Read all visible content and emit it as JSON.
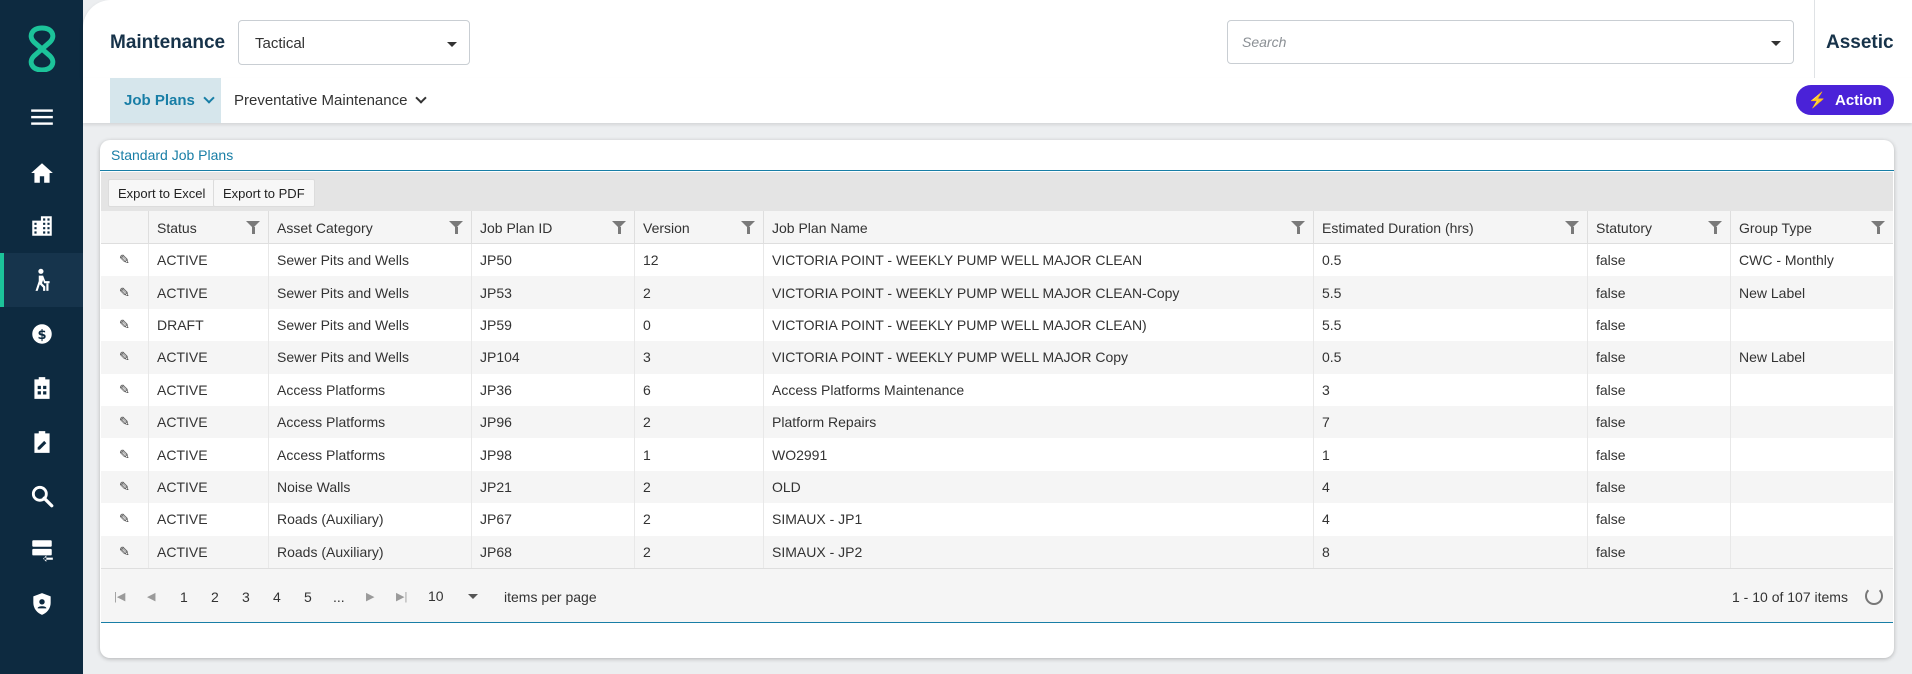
{
  "header": {
    "module_title": "Maintenance",
    "module_select": "Tactical",
    "search_placeholder": "Search",
    "brand": "Assetic"
  },
  "sidebar": {
    "items": [
      {
        "icon": "menu-icon"
      },
      {
        "icon": "home-icon"
      },
      {
        "icon": "buildings-icon"
      },
      {
        "icon": "worker-icon",
        "active": true
      },
      {
        "icon": "finance-icon"
      },
      {
        "icon": "clipboard-calc-icon"
      },
      {
        "icon": "clipboard-edit-icon"
      },
      {
        "icon": "search-icon"
      },
      {
        "icon": "server-import-icon"
      },
      {
        "icon": "admin-shield-icon"
      }
    ]
  },
  "subnav": {
    "tabs": [
      {
        "label": "Job Plans",
        "active": true
      },
      {
        "label": "Preventative Maintenance",
        "active": false
      }
    ],
    "action_label": "Action"
  },
  "card": {
    "title": "Standard Job Plans",
    "export_excel": "Export to Excel",
    "export_pdf": "Export to PDF"
  },
  "table": {
    "columns": [
      "Status",
      "Asset Category",
      "Job Plan ID",
      "Version",
      "Job Plan Name",
      "Estimated Duration (hrs)",
      "Statutory",
      "Group Type"
    ],
    "rows": [
      [
        "ACTIVE",
        "Sewer Pits and Wells",
        "JP50",
        "12",
        "VICTORIA POINT - WEEKLY PUMP WELL MAJOR CLEAN",
        "0.5",
        "false",
        "CWC - Monthly"
      ],
      [
        "ACTIVE",
        "Sewer Pits and Wells",
        "JP53",
        "2",
        "VICTORIA POINT - WEEKLY PUMP WELL MAJOR CLEAN-Copy",
        "5.5",
        "false",
        "New Label"
      ],
      [
        "DRAFT",
        "Sewer Pits and Wells",
        "JP59",
        "0",
        "VICTORIA POINT - WEEKLY PUMP WELL MAJOR CLEAN)",
        "5.5",
        "false",
        ""
      ],
      [
        "ACTIVE",
        "Sewer Pits and Wells",
        "JP104",
        "3",
        "VICTORIA POINT - WEEKLY PUMP WELL MAJOR Copy",
        "0.5",
        "false",
        "New Label"
      ],
      [
        "ACTIVE",
        "Access Platforms",
        "JP36",
        "6",
        "Access Platforms Maintenance",
        "3",
        "false",
        ""
      ],
      [
        "ACTIVE",
        "Access Platforms",
        "JP96",
        "2",
        "Platform Repairs",
        "7",
        "false",
        ""
      ],
      [
        "ACTIVE",
        "Access Platforms",
        "JP98",
        "1",
        "WO2991",
        "1",
        "false",
        ""
      ],
      [
        "ACTIVE",
        "Noise Walls",
        "JP21",
        "2",
        "OLD",
        "4",
        "false",
        ""
      ],
      [
        "ACTIVE",
        "Roads (Auxiliary)",
        "JP67",
        "2",
        "SIMAUX - JP1",
        "4",
        "false",
        ""
      ],
      [
        "ACTIVE",
        "Roads (Auxiliary)",
        "JP68",
        "2",
        "SIMAUX - JP2",
        "8",
        "false",
        ""
      ]
    ]
  },
  "pager": {
    "pages": [
      "1",
      "2",
      "3",
      "4",
      "5",
      "..."
    ],
    "page_size": "10",
    "items_per_page": "items per page",
    "summary": "1 - 10 of 107 items"
  },
  "colors": {
    "sidebar_bg": "#0d2a40",
    "accent_teal": "#187ea6",
    "action_purple": "#4a22d8",
    "logo_green": "#1cc39a"
  }
}
